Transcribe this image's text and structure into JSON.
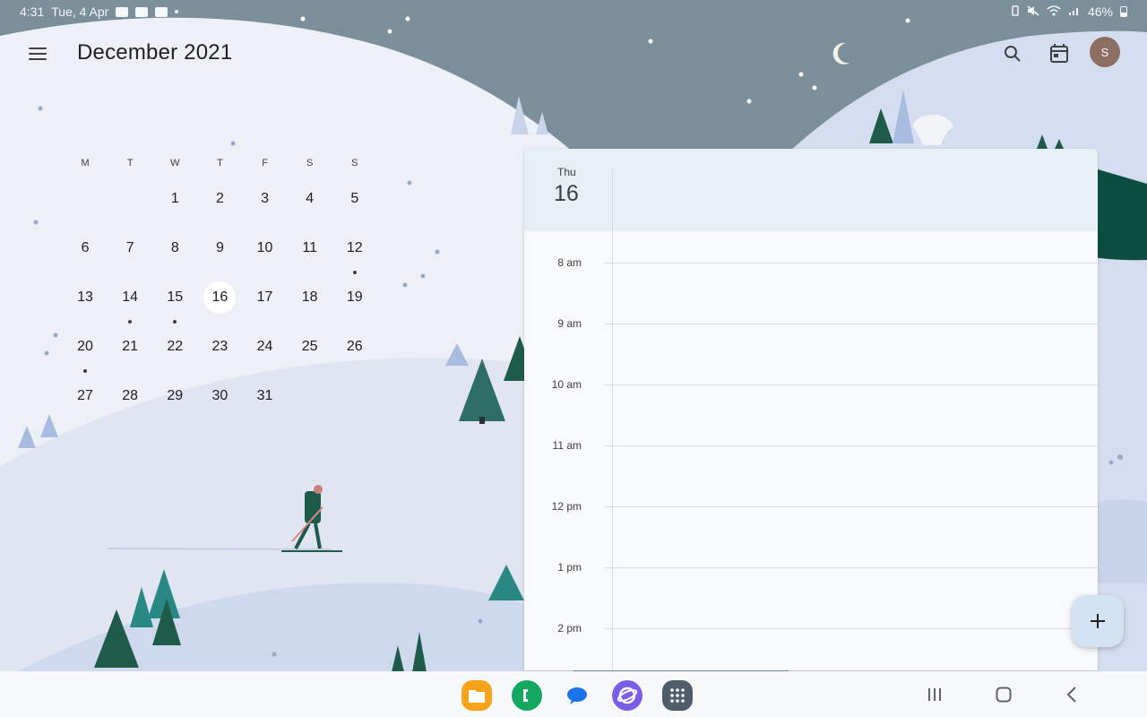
{
  "status_bar": {
    "time": "4:31",
    "date": "Tue, 4 Apr",
    "battery": "46%"
  },
  "header": {
    "month_title": "December 2021",
    "avatar_letter": "S"
  },
  "mini_calendar": {
    "weekdays": [
      "M",
      "T",
      "W",
      "T",
      "F",
      "S",
      "S"
    ],
    "selected_day": "16",
    "weeks": [
      [
        {
          "d": ""
        },
        {
          "d": ""
        },
        {
          "d": "1"
        },
        {
          "d": "2"
        },
        {
          "d": "3"
        },
        {
          "d": "4"
        },
        {
          "d": "5"
        }
      ],
      [
        {
          "d": "6"
        },
        {
          "d": "7"
        },
        {
          "d": "8"
        },
        {
          "d": "9"
        },
        {
          "d": "10"
        },
        {
          "d": "11"
        },
        {
          "d": "12",
          "dot": true
        }
      ],
      [
        {
          "d": "13"
        },
        {
          "d": "14",
          "dot": true
        },
        {
          "d": "15",
          "dot": true
        },
        {
          "d": "16"
        },
        {
          "d": "17"
        },
        {
          "d": "18"
        },
        {
          "d": "19"
        }
      ],
      [
        {
          "d": "20",
          "dot": true
        },
        {
          "d": "21"
        },
        {
          "d": "22"
        },
        {
          "d": "23"
        },
        {
          "d": "24"
        },
        {
          "d": "25"
        },
        {
          "d": "26"
        }
      ],
      [
        {
          "d": "27"
        },
        {
          "d": "28"
        },
        {
          "d": "29"
        },
        {
          "d": "30"
        },
        {
          "d": "31"
        },
        {
          "d": ""
        },
        {
          "d": ""
        }
      ]
    ]
  },
  "day_view": {
    "weekday": "Thu",
    "date": "16",
    "hours": [
      "8 am",
      "9 am",
      "10 am",
      "11 am",
      "12 pm",
      "1 pm",
      "2 pm"
    ]
  },
  "fab": {
    "icon": "plus-icon"
  },
  "dock": [
    "my-files",
    "phone",
    "messages",
    "internet",
    "apps"
  ],
  "colors": {
    "sky": "#7b8f9b",
    "snow": "#e9ecf4",
    "accent": "#d3e3f4",
    "tree_dark": "#1f5b4a",
    "tree_teal": "#2d8a86",
    "avatar": "#8d6e63"
  }
}
